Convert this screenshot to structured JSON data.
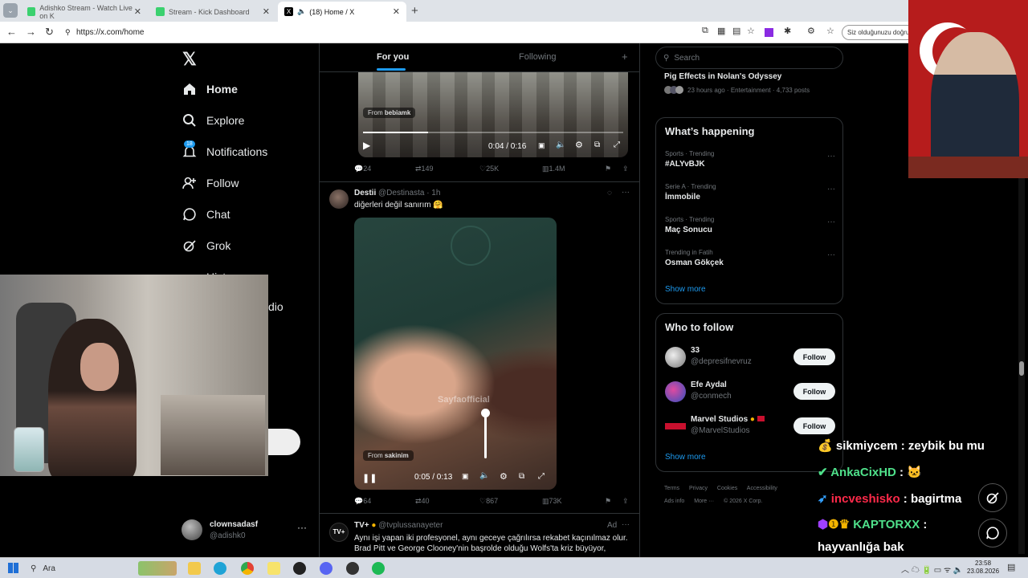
{
  "browser": {
    "tabs": [
      {
        "label": "Adishko Stream - Watch Live on K"
      },
      {
        "label": "Stream - Kick Dashboard"
      },
      {
        "label": "(18) Home / X"
      }
    ],
    "url": "https://x.com/home",
    "search_pill": "Siz olduğunuzu doğru"
  },
  "sidebar": {
    "items": [
      {
        "label": "Home",
        "icon": "home-icon"
      },
      {
        "label": "Explore",
        "icon": "search-icon"
      },
      {
        "label": "Notifications",
        "icon": "bell-icon",
        "badge": "18"
      },
      {
        "label": "Follow",
        "icon": "add-person-icon"
      },
      {
        "label": "Chat",
        "icon": "chat-icon"
      },
      {
        "label": "Grok",
        "icon": "grok-icon"
      },
      {
        "label": "History",
        "icon": "history-icon"
      },
      {
        "label": "dio",
        "icon": ""
      }
    ],
    "account": {
      "name": "clownsadasf",
      "handle": "@adishk0"
    }
  },
  "feed": {
    "tabs": [
      "For you",
      "Following"
    ],
    "post1": {
      "from": "From",
      "from_user": "bebiamk",
      "time": "0:04 / 0:16",
      "replies": "24",
      "reposts": "149",
      "likes": "25K",
      "views": "1.4M"
    },
    "post2": {
      "name": "Destii",
      "handle": "@Destinasta · 1h",
      "text": "diğerleri değil sanırım 🤗",
      "watermark": "Sayfaofficial",
      "from": "From",
      "from_user": "sakinim",
      "time": "0:05 / 0:13",
      "replies": "64",
      "reposts": "40",
      "likes": "867",
      "views": "73K"
    },
    "post3": {
      "name": "TV+",
      "handle": "@tvplussanayeter",
      "ad": "Ad",
      "text": "Aynı işi yapan iki profesyonel, aynı geceye çağrılırsa rekabet kaçınılmaz olur. Brad Pitt ve George Clooney'nin başrolde olduğu Wolfs'ta kriz büyüyor,"
    }
  },
  "right": {
    "search_placeholder": "Search",
    "top_item": {
      "title": "Pig Effects in Nolan's Odyssey",
      "meta": "23 hours ago · Entertainment · 4,733 posts"
    },
    "happening_title": "What’s happening",
    "trends": [
      {
        "category": "Sports · Trending",
        "name": "#ALYvBJK"
      },
      {
        "category": "Serie A · Trending",
        "name": "İmmobile"
      },
      {
        "category": "Sports · Trending",
        "name": "Maç Sonucu"
      },
      {
        "category": "Trending in Fatih",
        "name": "Osman Gökçek"
      }
    ],
    "show_more": "Show more",
    "who_title": "Who to follow",
    "who": [
      {
        "name": "33",
        "handle": "@depresifnevruz",
        "button": "Follow"
      },
      {
        "name": "Efe Aydal",
        "handle": "@conmech",
        "button": "Follow"
      },
      {
        "name": "Marvel Studios",
        "handle": "@MarvelStudios",
        "button": "Follow"
      }
    ],
    "footer": [
      "Terms",
      "Privacy",
      "Cookies",
      "Accessibility",
      "Ads info",
      "More ···",
      "© 2026 X Corp."
    ]
  },
  "chat": [
    {
      "user": "sikmiycem",
      "msg": " : zeybik bu mu",
      "color": "#ffffff"
    },
    {
      "user": "AnkaCixHD",
      "msg": " : ",
      "color": "#4fe08a"
    },
    {
      "user": "incveshisko",
      "msg": " : bagirtma",
      "color": "#ff2a4a"
    },
    {
      "user": "KAPTORXX",
      "msg": " :",
      "color": "#4fe08a"
    },
    {
      "user": "",
      "msg": "hayvanlığa bak",
      "color": "#ffffff"
    }
  ],
  "taskbar": {
    "search": "Ara",
    "time": "23:58",
    "date": "23.08.2026"
  }
}
